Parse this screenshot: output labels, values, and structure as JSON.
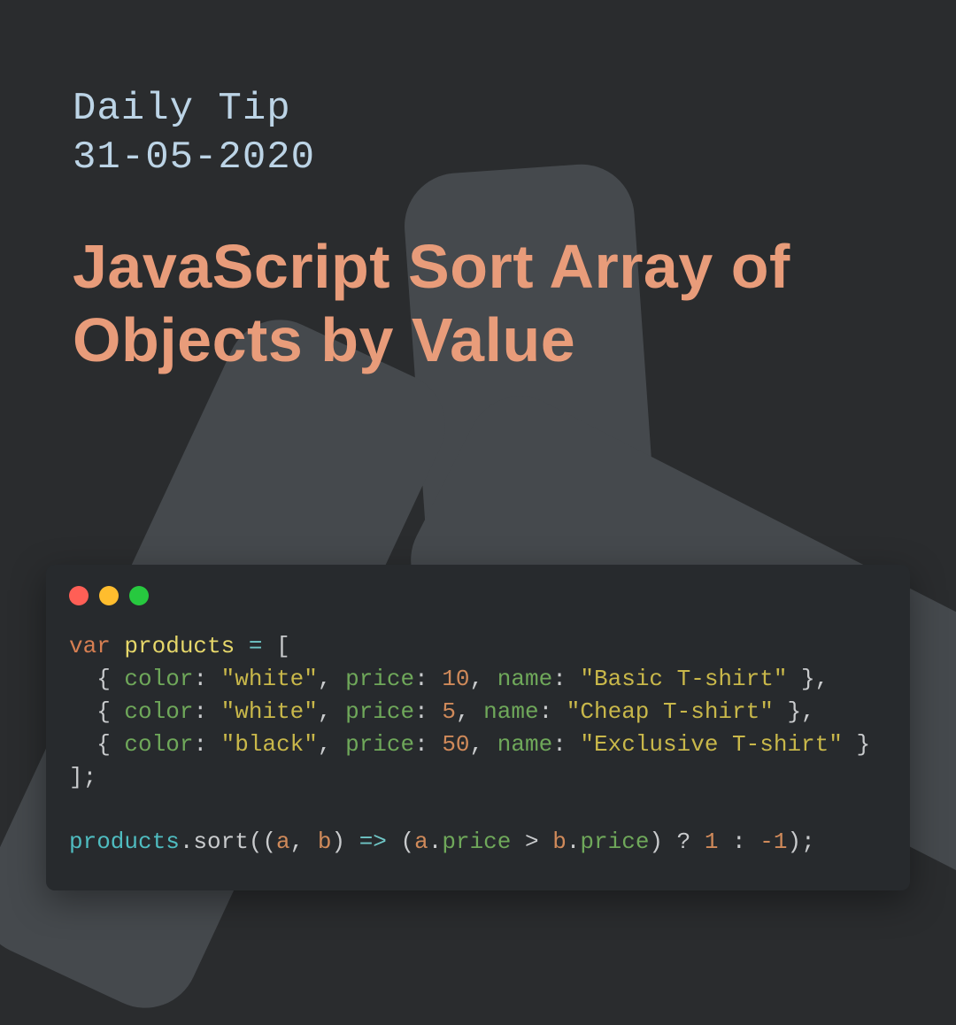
{
  "header": {
    "label": "Daily Tip",
    "date": "31-05-2020"
  },
  "headline": "JavaScript Sort Array of Objects by Value",
  "code": {
    "traffic": [
      "red",
      "yellow",
      "green"
    ],
    "lines": [
      {
        "tokens": [
          {
            "t": "var",
            "c": "tok-kw"
          },
          {
            "t": " ",
            "c": ""
          },
          {
            "t": "products",
            "c": "tok-var"
          },
          {
            "t": " ",
            "c": ""
          },
          {
            "t": "=",
            "c": "tok-op"
          },
          {
            "t": " [",
            "c": "tok-punc"
          }
        ]
      },
      {
        "tokens": [
          {
            "t": "  { ",
            "c": "tok-punc"
          },
          {
            "t": "color",
            "c": "tok-key"
          },
          {
            "t": ": ",
            "c": "tok-punc"
          },
          {
            "t": "\"white\"",
            "c": "tok-str"
          },
          {
            "t": ", ",
            "c": "tok-punc"
          },
          {
            "t": "price",
            "c": "tok-key"
          },
          {
            "t": ": ",
            "c": "tok-punc"
          },
          {
            "t": "10",
            "c": "tok-num"
          },
          {
            "t": ", ",
            "c": "tok-punc"
          },
          {
            "t": "name",
            "c": "tok-key"
          },
          {
            "t": ": ",
            "c": "tok-punc"
          },
          {
            "t": "\"Basic T-shirt\"",
            "c": "tok-str"
          },
          {
            "t": " },",
            "c": "tok-punc"
          }
        ]
      },
      {
        "tokens": [
          {
            "t": "  { ",
            "c": "tok-punc"
          },
          {
            "t": "color",
            "c": "tok-key"
          },
          {
            "t": ": ",
            "c": "tok-punc"
          },
          {
            "t": "\"white\"",
            "c": "tok-str"
          },
          {
            "t": ", ",
            "c": "tok-punc"
          },
          {
            "t": "price",
            "c": "tok-key"
          },
          {
            "t": ": ",
            "c": "tok-punc"
          },
          {
            "t": "5",
            "c": "tok-num"
          },
          {
            "t": ", ",
            "c": "tok-punc"
          },
          {
            "t": "name",
            "c": "tok-key"
          },
          {
            "t": ": ",
            "c": "tok-punc"
          },
          {
            "t": "\"Cheap T-shirt\"",
            "c": "tok-str"
          },
          {
            "t": " },",
            "c": "tok-punc"
          }
        ]
      },
      {
        "tokens": [
          {
            "t": "  { ",
            "c": "tok-punc"
          },
          {
            "t": "color",
            "c": "tok-key"
          },
          {
            "t": ": ",
            "c": "tok-punc"
          },
          {
            "t": "\"black\"",
            "c": "tok-str"
          },
          {
            "t": ", ",
            "c": "tok-punc"
          },
          {
            "t": "price",
            "c": "tok-key"
          },
          {
            "t": ": ",
            "c": "tok-punc"
          },
          {
            "t": "50",
            "c": "tok-num"
          },
          {
            "t": ", ",
            "c": "tok-punc"
          },
          {
            "t": "name",
            "c": "tok-key"
          },
          {
            "t": ": ",
            "c": "tok-punc"
          },
          {
            "t": "\"Exclusive T-shirt\"",
            "c": "tok-str"
          },
          {
            "t": " }",
            "c": "tok-punc"
          }
        ]
      },
      {
        "tokens": [
          {
            "t": "];",
            "c": "tok-punc"
          }
        ]
      },
      {
        "tokens": [
          {
            "t": " ",
            "c": ""
          }
        ]
      },
      {
        "tokens": [
          {
            "t": "products",
            "c": "tok-call"
          },
          {
            "t": ".sort((",
            "c": "tok-punc"
          },
          {
            "t": "a",
            "c": "tok-param"
          },
          {
            "t": ", ",
            "c": "tok-punc"
          },
          {
            "t": "b",
            "c": "tok-param"
          },
          {
            "t": ") ",
            "c": "tok-punc"
          },
          {
            "t": "=>",
            "c": "tok-op"
          },
          {
            "t": " (",
            "c": "tok-punc"
          },
          {
            "t": "a",
            "c": "tok-param"
          },
          {
            "t": ".",
            "c": "tok-punc"
          },
          {
            "t": "price",
            "c": "tok-prop"
          },
          {
            "t": " > ",
            "c": "tok-punc"
          },
          {
            "t": "b",
            "c": "tok-param"
          },
          {
            "t": ".",
            "c": "tok-punc"
          },
          {
            "t": "price",
            "c": "tok-prop"
          },
          {
            "t": ") ? ",
            "c": "tok-punc"
          },
          {
            "t": "1",
            "c": "tok-num"
          },
          {
            "t": " : ",
            "c": "tok-punc"
          },
          {
            "t": "-1",
            "c": "tok-num"
          },
          {
            "t": ");",
            "c": "tok-punc"
          }
        ]
      }
    ]
  }
}
